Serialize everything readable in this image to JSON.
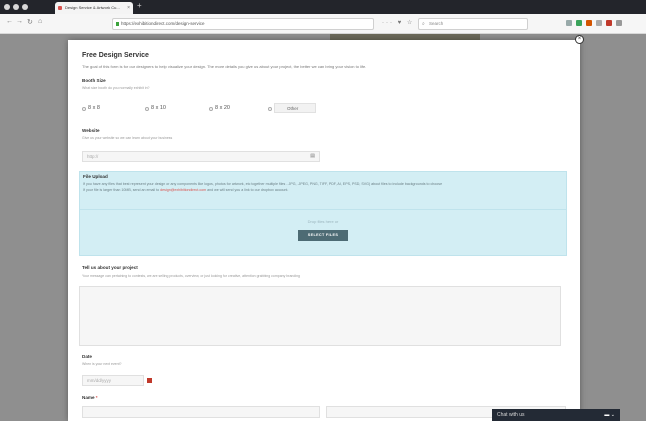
{
  "browser": {
    "tab_title": "Design Service & Artwork Cu...",
    "tab_close": "×",
    "new_tab": "+",
    "nav_back": "←",
    "nav_forward": "→",
    "nav_reload": "↻",
    "nav_home": "⌂",
    "url": "https://exhibitiondirect.com/design-service",
    "url_actions": "··· ♥ ☆",
    "search_placeholder": "Search",
    "search_glyph": "⌕"
  },
  "modal": {
    "close": "×",
    "title": "Free Design Service",
    "intro": "The goal of this form is for our designers to help visualize your design. The more details you give us about your project, the better we can bring your vision to life.",
    "booth_size": {
      "label": "Booth Size",
      "hint": "What size booth do you normally exhibit in?",
      "options": [
        "8 x 8",
        "8 x 10",
        "8 x 20",
        "Other"
      ]
    },
    "website": {
      "label": "Website",
      "hint": "Give us your website so we can learn about your business",
      "placeholder": "http://",
      "icon": "▤"
    },
    "file_upload": {
      "label": "File Upload",
      "line1": "If you have any files that best represent your design or any components like logos, photos for artwork, etc together multiple files - JPG, .JPEG, PNG, TIFF, PDF, AI, EPS, PSD, SVG) about files to include backgrounds to choose",
      "line2_pre": "If your file is larger than 10MB, send an email to ",
      "line2_link": "design@exhibitiondirect.com",
      "line2_post": " and we will send you a link to our dropbox account.",
      "drop_hint": "Drop files here or",
      "button": "SELECT FILES"
    },
    "project": {
      "label": "Tell us about your project",
      "hint": "Your message can pertaining to contests, we are selling products, overview, or just looking for creative, attention grabbing company branding"
    },
    "date": {
      "label": "Date",
      "hint": "When is your next event?",
      "placeholder": "mm/dd/yyyy"
    },
    "name": {
      "label": "Name",
      "required": "*"
    }
  },
  "chat": {
    "label": "Chat with us",
    "icons": "▬ ⌄"
  },
  "colors": {
    "accent": "#d9534f",
    "upload_bg": "#d3eef4",
    "button_bg": "#4d6b74",
    "chat_bg": "#232a35"
  }
}
